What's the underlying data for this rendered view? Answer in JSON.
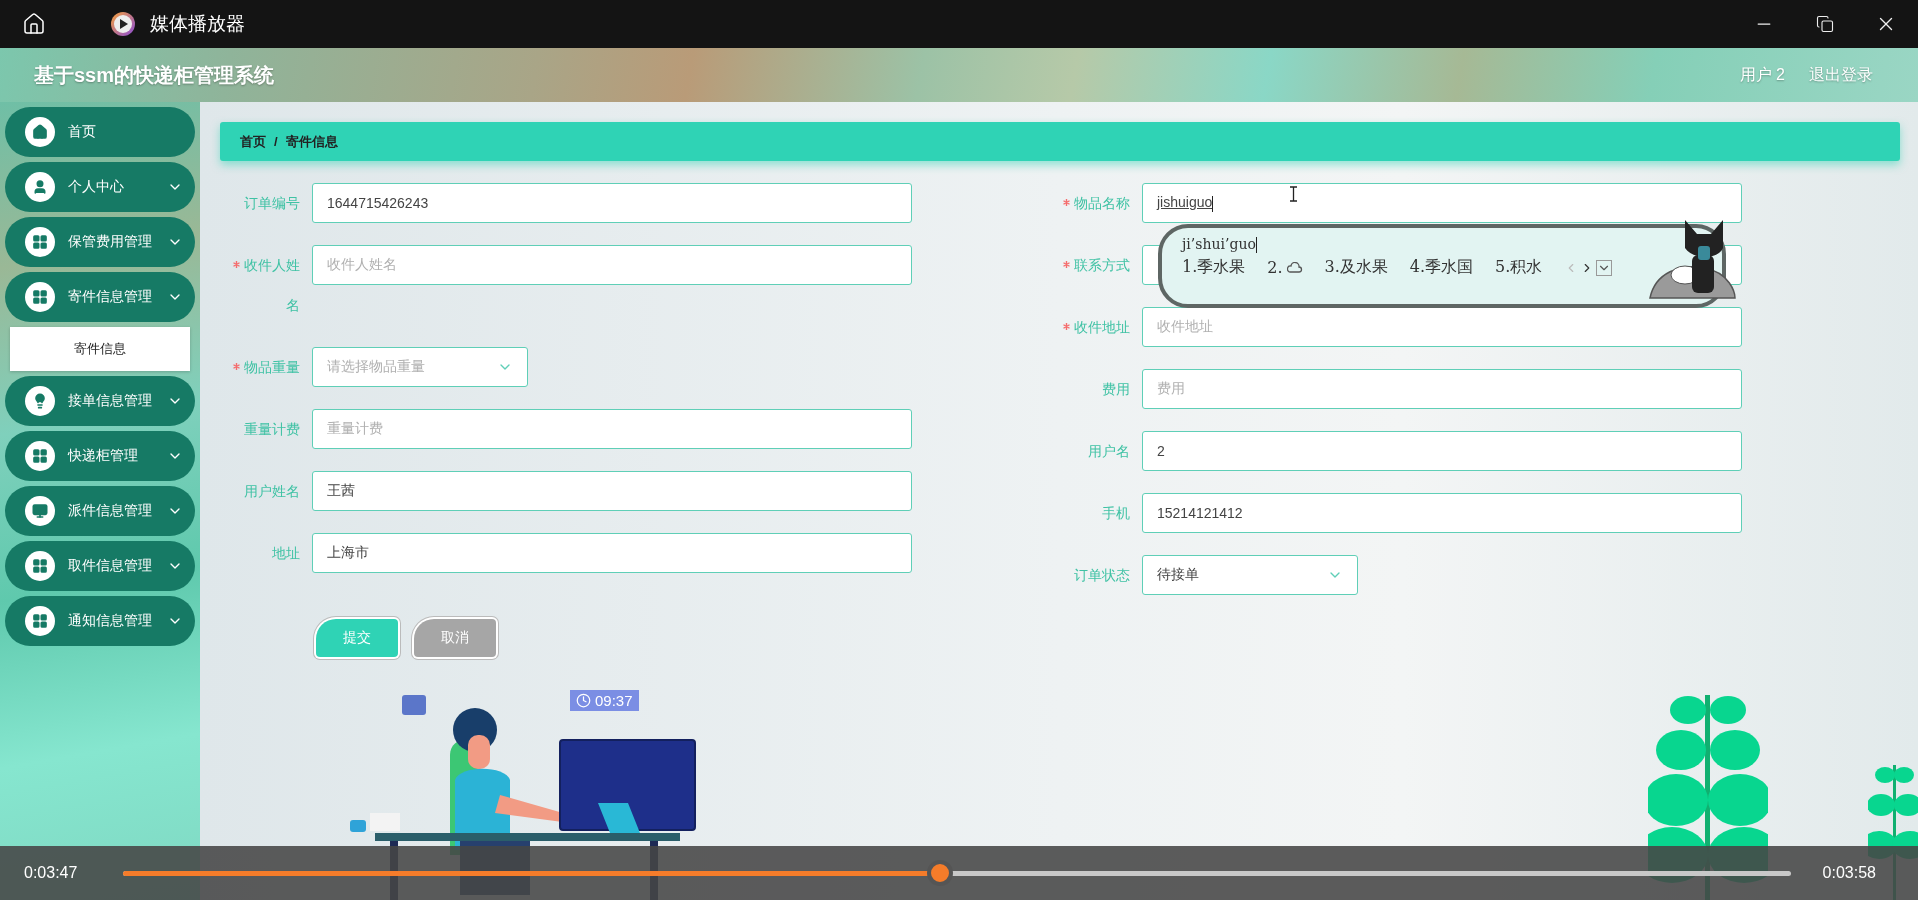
{
  "window": {
    "title": "媒体播放器"
  },
  "app": {
    "title": "基于ssm的快递柜管理系统",
    "user": "用户 2",
    "logout": "退出登录"
  },
  "sidebar": {
    "items": [
      {
        "label": "首页",
        "collapsible": false
      },
      {
        "label": "个人中心",
        "collapsible": true,
        "expanded": false
      },
      {
        "label": "保管费用管理",
        "collapsible": true,
        "expanded": false
      },
      {
        "label": "寄件信息管理",
        "collapsible": true,
        "expanded": true,
        "children": [
          {
            "label": "寄件信息",
            "selected": true
          }
        ]
      },
      {
        "label": "接单信息管理",
        "collapsible": true,
        "expanded": false
      },
      {
        "label": "快递柜管理",
        "collapsible": true,
        "expanded": false
      },
      {
        "label": "派件信息管理",
        "collapsible": true,
        "expanded": false
      },
      {
        "label": "取件信息管理",
        "collapsible": true,
        "expanded": false
      },
      {
        "label": "通知信息管理",
        "collapsible": true,
        "expanded": false
      }
    ]
  },
  "breadcrumb": [
    "首页",
    "/",
    "寄件信息"
  ],
  "form": {
    "left": [
      {
        "label": "订单编号",
        "required": false,
        "kind": "input",
        "value": "1644715426243"
      },
      {
        "label": "收件人姓名",
        "required": true,
        "kind": "input",
        "placeholder": "收件人姓名"
      },
      {
        "label": "物品重量",
        "required": true,
        "kind": "select",
        "placeholder": "请选择物品重量"
      },
      {
        "label": "重量计费",
        "required": false,
        "kind": "input",
        "placeholder": "重量计费"
      },
      {
        "label": "用户姓名",
        "required": false,
        "kind": "input",
        "value": "王茜"
      },
      {
        "label": "地址",
        "required": false,
        "kind": "input",
        "value": "上海市"
      }
    ],
    "right": [
      {
        "label": "物品名称",
        "required": true,
        "kind": "input",
        "value": "jishuiguo",
        "composing": true
      },
      {
        "label": "联系方式",
        "required": true,
        "kind": "input"
      },
      {
        "label": "收件地址",
        "required": true,
        "kind": "input",
        "placeholder": "收件地址"
      },
      {
        "label": "费用",
        "required": false,
        "kind": "input",
        "placeholder": "费用"
      },
      {
        "label": "用户名",
        "required": false,
        "kind": "input",
        "value": "2"
      },
      {
        "label": "手机",
        "required": false,
        "kind": "input",
        "value": "15214121412"
      },
      {
        "label": "订单状态",
        "required": false,
        "kind": "select",
        "value": "待接单"
      }
    ],
    "buttons": [
      {
        "label": "提交",
        "kind": "primary"
      },
      {
        "label": "取消",
        "kind": "secondary"
      }
    ]
  },
  "ime": {
    "composition": "ji’shui’guo",
    "candidates": [
      {
        "label": "1.季水果",
        "kind": "text"
      },
      {
        "label": "2.",
        "kind": "icon"
      },
      {
        "label": "3.及水果",
        "kind": "text"
      },
      {
        "label": "4.季水国",
        "kind": "text"
      },
      {
        "label": "5.积水",
        "kind": "text"
      }
    ]
  },
  "illustration": {
    "clock": "09:37"
  },
  "player": {
    "elapsed": "0:03:47",
    "duration": "0:03:58",
    "level": 0.49
  }
}
